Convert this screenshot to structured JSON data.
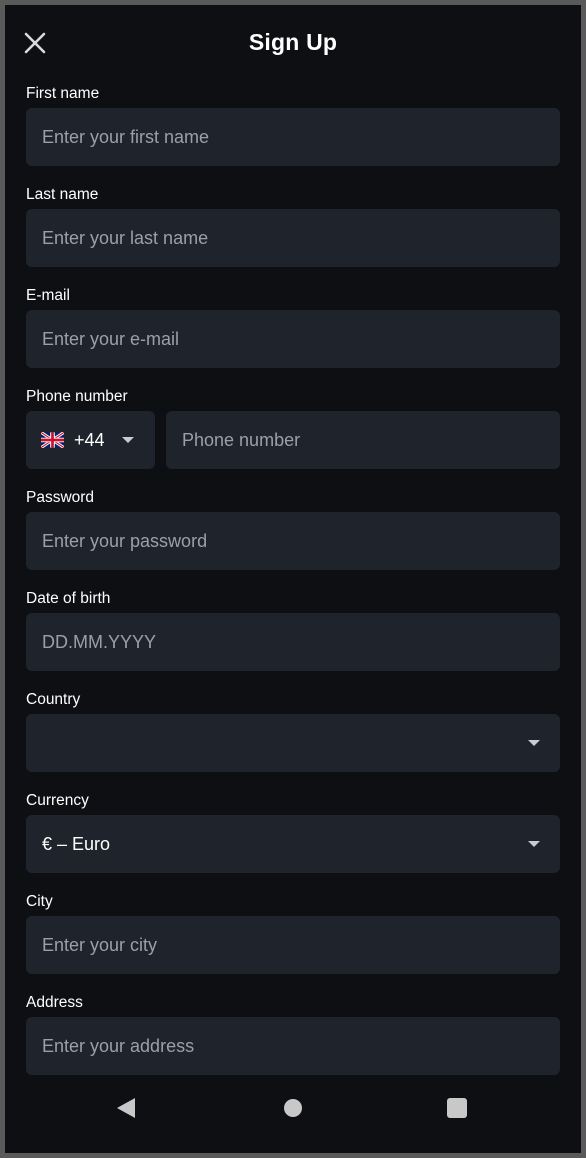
{
  "header": {
    "title": "Sign Up",
    "close_icon": "close-icon"
  },
  "fields": {
    "first_name": {
      "label": "First name",
      "placeholder": "Enter your first name",
      "value": ""
    },
    "last_name": {
      "label": "Last name",
      "placeholder": "Enter your last name",
      "value": ""
    },
    "email": {
      "label": "E-mail",
      "placeholder": "Enter your e-mail",
      "value": ""
    },
    "phone": {
      "label": "Phone number",
      "country_code": "+44",
      "flag_icon": "uk-flag-icon",
      "placeholder": "Phone number",
      "value": ""
    },
    "password": {
      "label": "Password",
      "placeholder": "Enter your password",
      "value": ""
    },
    "dob": {
      "label": "Date of birth",
      "placeholder": "DD.MM.YYYY",
      "value": ""
    },
    "country": {
      "label": "Country",
      "value": ""
    },
    "currency": {
      "label": "Currency",
      "value": "€ – Euro"
    },
    "city": {
      "label": "City",
      "placeholder": "Enter your city",
      "value": ""
    },
    "address": {
      "label": "Address",
      "placeholder": "Enter your address",
      "value": ""
    }
  },
  "navbar": {
    "back_icon": "back-icon",
    "home_icon": "home-icon",
    "recents_icon": "recents-icon"
  },
  "colors": {
    "background": "#0d0f13",
    "input_background": "#1f232b",
    "text": "#ffffff",
    "placeholder": "#9aa0aa"
  }
}
